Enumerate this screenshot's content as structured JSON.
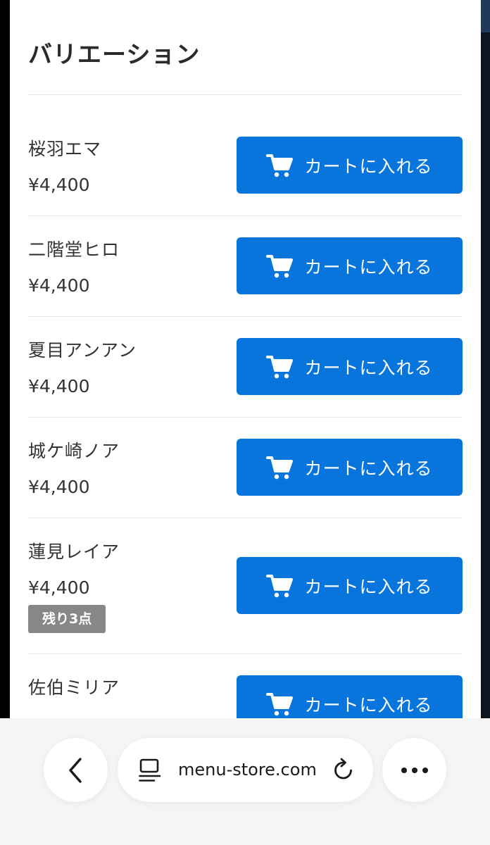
{
  "sheet": {
    "title": "バリエーション"
  },
  "variants": [
    {
      "name": "桜羽エマ",
      "price": "¥4,400",
      "button_label": "カートに入れる",
      "stock_badge": ""
    },
    {
      "name": "二階堂ヒロ",
      "price": "¥4,400",
      "button_label": "カートに入れる",
      "stock_badge": ""
    },
    {
      "name": "夏目アンアン",
      "price": "¥4,400",
      "button_label": "カートに入れる",
      "stock_badge": ""
    },
    {
      "name": "城ケ崎ノア",
      "price": "¥4,400",
      "button_label": "カートに入れる",
      "stock_badge": ""
    },
    {
      "name": "蓮見レイア",
      "price": "¥4,400",
      "button_label": "カートに入れる",
      "stock_badge": "残り3点"
    },
    {
      "name": "佐伯ミリア",
      "price": "",
      "button_label": "カートに入れる",
      "stock_badge": ""
    }
  ],
  "browser": {
    "url": "menu-store.com",
    "back_icon": "chevron-left-icon",
    "reader_icon": "reader-mode-icon",
    "reload_icon": "reload-icon",
    "more_icon": "more-horizontal-icon"
  },
  "colors": {
    "accent": "#0875dd",
    "badge": "#878787",
    "text": "#333333"
  }
}
